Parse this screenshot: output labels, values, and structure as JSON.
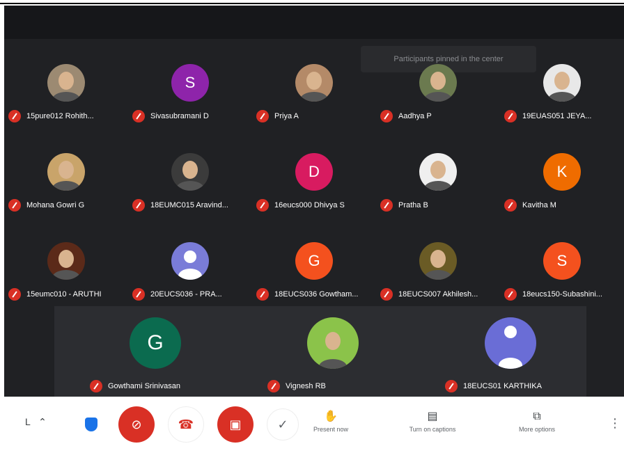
{
  "pinned_toast": "Participants pinned in the center",
  "grid": [
    {
      "name": "15pure012 Rohith...",
      "avatar": "photo",
      "avatar_color": "#9c8a72"
    },
    {
      "name": "Sivasubramani D",
      "avatar": "letter",
      "letter": "S",
      "avatar_color": "#8e24aa"
    },
    {
      "name": "Priya A",
      "avatar": "photo",
      "avatar_color": "#b48a68"
    },
    {
      "name": "Aadhya P",
      "avatar": "photo",
      "avatar_color": "#6b7a4f"
    },
    {
      "name": "19EUAS051 JEYA...",
      "avatar": "photo",
      "avatar_color": "#e8e8e8"
    },
    {
      "name": "Mohana Gowri G",
      "avatar": "photo",
      "avatar_color": "#c9a46a"
    },
    {
      "name": "18EUMC015 Aravind...",
      "avatar": "photo",
      "avatar_color": "#3b3b3b"
    },
    {
      "name": "16eucs000 Dhivya S",
      "avatar": "letter",
      "letter": "D",
      "avatar_color": "#d81b60"
    },
    {
      "name": "Pratha B",
      "avatar": "photo",
      "avatar_color": "#efefef"
    },
    {
      "name": "Kavitha M",
      "avatar": "letter",
      "letter": "K",
      "avatar_color": "#ef6c00"
    },
    {
      "name": "15eumc010 - ARUTHI",
      "avatar": "photo",
      "avatar_color": "#5b2a19"
    },
    {
      "name": "20EUCS036 - PRA...",
      "avatar": "generic",
      "avatar_color": "#7a7cd8"
    },
    {
      "name": "18EUCS036 Gowtham...",
      "avatar": "letter",
      "letter": "G",
      "avatar_color": "#f4511e"
    },
    {
      "name": "18EUCS007 Akhilesh...",
      "avatar": "photo",
      "avatar_color": "#6a5b25"
    },
    {
      "name": "18eucs150-Subashini...",
      "avatar": "letter",
      "letter": "S",
      "avatar_color": "#f4511e"
    }
  ],
  "strip": [
    {
      "name": "Gowthami Srinivasan",
      "avatar": "letter",
      "letter": "G",
      "avatar_color": "#0b6b4f"
    },
    {
      "name": "Vignesh RB",
      "avatar": "photo",
      "avatar_color": "#8bc34a"
    },
    {
      "name": "18EUCS01 KARTHIKA",
      "avatar": "generic",
      "avatar_color": "#6a6dd6"
    }
  ],
  "controls": {
    "meeting_code": "L",
    "present_label": "Present now",
    "captions_label": "Turn on captions",
    "more_label": "More options"
  },
  "colors": {
    "stage": "#202124",
    "mute": "#d93025",
    "controls_bg": "#ffffff"
  }
}
